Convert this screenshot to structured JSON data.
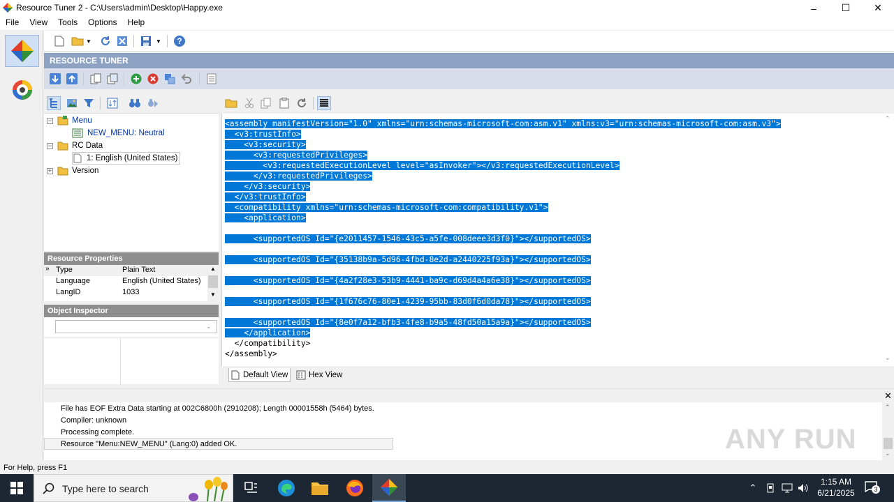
{
  "window": {
    "title": "Resource Tuner 2 - C:\\Users\\admin\\Desktop\\Happy.exe",
    "controls": {
      "minimize": "–",
      "maximize": "☐",
      "close": "✕"
    }
  },
  "menu": {
    "items": [
      {
        "label": "File"
      },
      {
        "label": "View"
      },
      {
        "label": "Tools"
      },
      {
        "label": "Options"
      },
      {
        "label": "Help"
      }
    ]
  },
  "header": {
    "title": "RESOURCE TUNER"
  },
  "tree": {
    "nodes": [
      {
        "label": "Menu",
        "expander": "−",
        "icon": "menu-folder-icon"
      },
      {
        "label": "NEW_MENU: Neutral",
        "icon": "menu-resource-icon"
      },
      {
        "label": "RC Data",
        "expander": "−",
        "icon": "folder-icon"
      },
      {
        "label": "1: English (United States)",
        "icon": "document-icon"
      },
      {
        "label": "Version",
        "expander": "+",
        "icon": "folder-icon"
      }
    ]
  },
  "properties": {
    "title": "Resource Properties",
    "rows": [
      {
        "key": "Type",
        "value": "Plain Text"
      },
      {
        "key": "Language",
        "value": "English (United States)"
      },
      {
        "key": "LangID",
        "value": "1033"
      }
    ]
  },
  "object_inspector": {
    "title": "Object Inspector",
    "dropdown_value": ""
  },
  "editor": {
    "lines": [
      "<assembly manifestVersion=\"1.0\" xmlns=\"urn:schemas-microsoft-com:asm.v1\" xmlns:v3=\"urn:schemas-microsoft-com:asm.v3\">",
      "  <v3:trustInfo>",
      "    <v3:security>",
      "      <v3:requestedPrivileges>",
      "        <v3:requestedExecutionLevel level=\"asInvoker\"></v3:requestedExecutionLevel>",
      "      </v3:requestedPrivileges>",
      "    </v3:security>",
      "  </v3:trustInfo>",
      "  <compatibility xmlns=\"urn:schemas-microsoft-com:compatibility.v1\">",
      "    <application>",
      "",
      "      <supportedOS Id=\"{e2011457-1546-43c5-a5fe-008deee3d3f0}\"></supportedOS>",
      "",
      "      <supportedOS Id=\"{35138b9a-5d96-4fbd-8e2d-a2440225f93a}\"></supportedOS>",
      "",
      "      <supportedOS Id=\"{4a2f28e3-53b9-4441-ba9c-d69d4a4a6e38}\"></supportedOS>",
      "",
      "      <supportedOS Id=\"{1f676c76-80e1-4239-95bb-83d0f6d0da78}\"></supportedOS>",
      "",
      "      <supportedOS Id=\"{8e0f7a12-bfb3-4fe8-b9a5-48fd50a15a9a}\"></supportedOS>",
      "    </application>",
      "  </compatibility>",
      "</assembly>"
    ]
  },
  "view_tabs": [
    {
      "label": "Default View"
    },
    {
      "label": "Hex View"
    }
  ],
  "log": {
    "lines": [
      "File has EOF Extra Data starting at 002C6800h (2910208); Length 00001558h (5464) bytes.",
      "Compiler: unknown",
      "Processing complete.",
      "Resource \"Menu:NEW_MENU\" (Lang:0) added OK."
    ]
  },
  "statusbar": {
    "text": "For Help, press F1"
  },
  "taskbar": {
    "search_placeholder": "Type here to search",
    "time": "1:15 AM",
    "date": "6/21/2025",
    "notification_count": "3"
  },
  "watermark": {
    "text": "ANY RUN"
  },
  "colors": {
    "selection": "#0078d7",
    "header_band": "#8ea2c4",
    "panel_title": "#8e8e8e",
    "taskbar": "#1c2733"
  }
}
